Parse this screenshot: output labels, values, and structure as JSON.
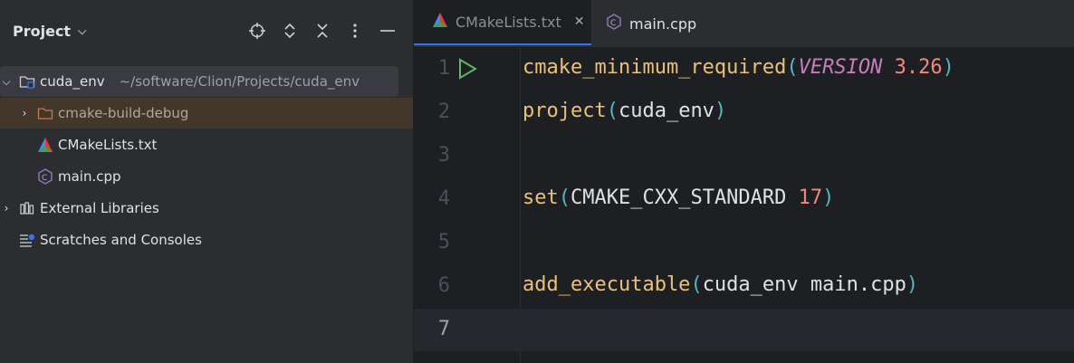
{
  "sidebar": {
    "title": "Project",
    "tools": [
      "locate-icon",
      "expand-all-icon",
      "collapse-all-icon",
      "more-icon",
      "minimize-icon"
    ],
    "tree": {
      "root": {
        "label": "cuda_env",
        "path": "~/software/Clion/Projects/cuda_env"
      },
      "build_folder": "cmake-build-debug",
      "cmake_file": "CMakeLists.txt",
      "main_file": "main.cpp",
      "external": "External Libraries",
      "scratches": "Scratches and Consoles"
    }
  },
  "tabs": [
    {
      "label": "CMakeLists.txt",
      "active": true
    },
    {
      "label": "main.cpp",
      "active": false
    }
  ],
  "editor": {
    "lines": [
      {
        "n": "1",
        "fn": "cmake_minimum_required",
        "o": "(",
        "kw": "VERSION",
        "sp": " ",
        "num": "3.26",
        "c": ")"
      },
      {
        "n": "2",
        "fn": "project",
        "o": "(",
        "text": "cuda_env",
        "c": ")"
      },
      {
        "n": "3"
      },
      {
        "n": "4",
        "fn": "set",
        "o": "(",
        "text": "CMAKE_CXX_STANDARD ",
        "num": "17",
        "c": ")"
      },
      {
        "n": "5"
      },
      {
        "n": "6",
        "fn": "add_executable",
        "o": "(",
        "text": "cuda_env main.cpp",
        "c": ")"
      },
      {
        "n": "7"
      }
    ]
  },
  "colors": {
    "accent": "#3574f0",
    "function": "#e8c17a",
    "number": "#ef8a7a",
    "keyword": "#c77dbb",
    "paren": "#56b6c2"
  }
}
